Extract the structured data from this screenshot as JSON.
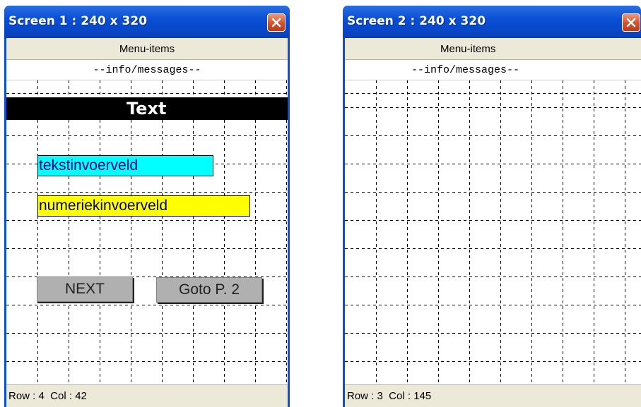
{
  "screens": [
    {
      "title": "Screen 1 : 240 x 320",
      "menu": "Menu-items",
      "info": "--info/messages--",
      "status": "Row : 4  Col : 42",
      "text_heading": "Text",
      "text_field": "tekstinvoerveld",
      "numeric_field": "numeriekinvoerveld",
      "next_button": "NEXT",
      "goto_button": "Goto P. 2"
    },
    {
      "title": "Screen 2 : 240 x 320",
      "menu": "Menu-items",
      "info": "--info/messages--",
      "status": "Row : 3  Col : 145"
    }
  ],
  "colors": {
    "titlebar": "#0a4fd6",
    "close_button": "#d4502a",
    "text_field_bg": "#00ffff",
    "numeric_field_bg": "#ffff00",
    "button_bg": "#b0b0b0"
  },
  "icons": {
    "close": "close-icon"
  }
}
